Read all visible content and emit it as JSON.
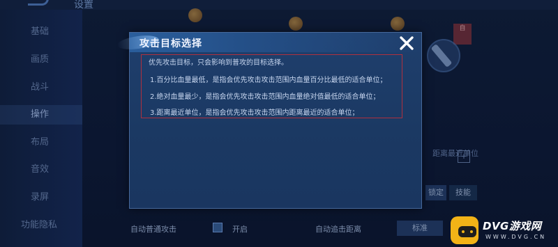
{
  "screen": {
    "title": "设置",
    "sidebar": [
      "基础",
      "画质",
      "战斗",
      "操作",
      "布局",
      "音效",
      "录屏",
      "功能隐私"
    ],
    "active_sidebar_index": 3,
    "right_texts": [
      "距离最近单位",
      "锁定",
      "技能"
    ],
    "right_tag": "自",
    "bottom": {
      "auto_attack_label": "自动普通攻击",
      "auto_attack_value": "开启",
      "auto_chase_label": "自动追击距离",
      "auto_chase_button": "标准"
    }
  },
  "dialog": {
    "title": "攻击目标选择",
    "intro": "优先攻击目标，只会影响到普攻的目标选择。",
    "options": [
      "1.百分比血量最低，是指会优先攻击攻击范围内血量百分比最低的适合单位；",
      "2.绝对血量最少，是指会优先攻击攻击范围内血量绝对值最低的适合单位；",
      "3.距离最近单位，是指会优先攻击攻击范围内距离最近的适合单位；"
    ]
  },
  "watermark": {
    "main": "DVG游戏网",
    "sub": "WWW.DVG.CN"
  },
  "colors": {
    "dialog_bg": "#1f3f6d",
    "highlight_border": "#b0303e",
    "watermark_yellow": "#f2b317"
  },
  "icons": {
    "close": "close-icon",
    "back": "back-arrow-icon",
    "gamepad": "gamepad-icon"
  }
}
